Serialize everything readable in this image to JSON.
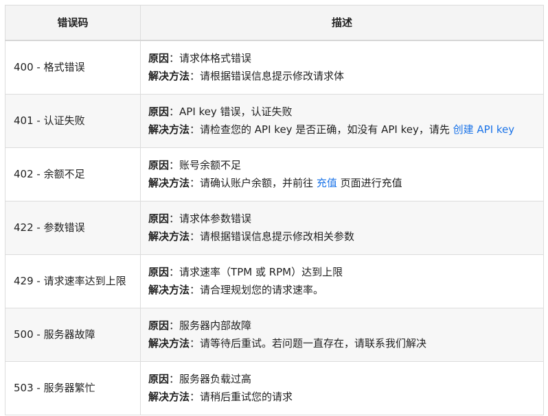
{
  "table": {
    "headers": {
      "code": "错误码",
      "description": "描述"
    },
    "reason_label": "原因",
    "solution_label": "解决方法",
    "colon": "：",
    "rows": [
      {
        "code": "400 - 格式错误",
        "reason": "请求体格式错误",
        "solution_before": "请根据错误信息提示修改请求体"
      },
      {
        "code": "401 - 认证失败",
        "reason": "API key 错误，认证失败",
        "solution_before": "请检查您的 API key 是否正确，如没有 API key，请先 ",
        "solution_link": "创建 API key",
        "solution_after": ""
      },
      {
        "code": "402 - 余额不足",
        "reason": "账号余额不足",
        "solution_before": "请确认账户余额，并前往 ",
        "solution_link": "充值",
        "solution_after": " 页面进行充值"
      },
      {
        "code": "422 - 参数错误",
        "reason": "请求体参数错误",
        "solution_before": "请根据错误信息提示修改相关参数"
      },
      {
        "code": "429 - 请求速率达到上限",
        "reason": "请求速率（TPM 或 RPM）达到上限",
        "solution_before": "请合理规划您的请求速率。"
      },
      {
        "code": "500 - 服务器故障",
        "reason": "服务器内部故障",
        "solution_before": "请等待后重试。若问题一直存在，请联系我们解决"
      },
      {
        "code": "503 - 服务器繁忙",
        "reason": "服务器负载过高",
        "solution_before": "请稍后重试您的请求"
      }
    ]
  },
  "colors": {
    "link": "#1a73e8",
    "border": "#dcdcdc",
    "header_bg": "#f4f4f4",
    "stripe_bg": "#f7f7f7"
  }
}
